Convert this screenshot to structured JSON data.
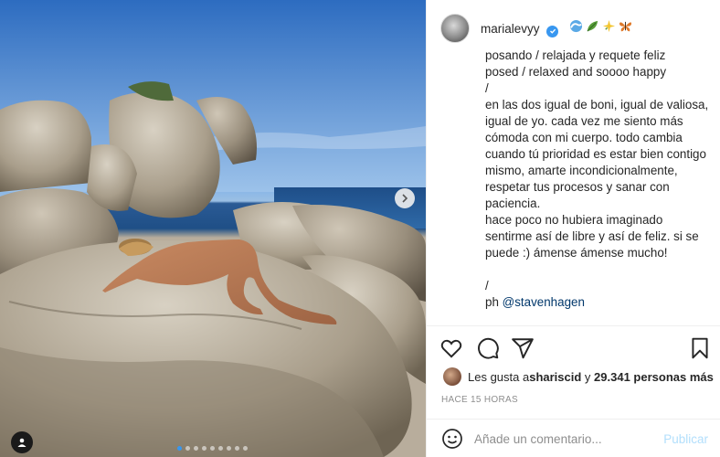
{
  "post": {
    "username": "marialevyy",
    "verified": true,
    "emoji_icons": [
      "wave-emoji-icon",
      "leaf-emoji-icon",
      "sparkle-emoji-icon",
      "butterfly-emoji-icon"
    ],
    "caption_lines": [
      "posando / relajada y requete feliz",
      "posed / relaxed and soooo happy",
      "/",
      "en las dos igual de boni, igual de valiosa, igual de yo. cada vez me siento más cómoda con mi cuerpo. todo cambia cuando tú prioridad es estar bien contigo mismo, amarte incondicionalmente, respetar tus procesos y sanar con paciencia.",
      "hace poco no hubiera imaginado sentirme así de libre y así de feliz. si se puede :) ámense ámense mucho!",
      "",
      "/"
    ],
    "credit_prefix": "ph ",
    "credit_mention": "@stavenhagen",
    "likes_prefix": "Les gusta a ",
    "likes_user": "shariscid",
    "likes_joiner": " y ",
    "likes_count": "29.341 personas más",
    "timestamp": "Hace 15 horas",
    "comment_placeholder": "Añade un comentario...",
    "publish_label": "Publicar",
    "carousel": {
      "slides": 9,
      "active_index": 0
    }
  },
  "colors": {
    "accent": "#3897f0",
    "publish_disabled": "#b2dffc",
    "link": "#00376b",
    "muted": "#8e8e8e"
  }
}
